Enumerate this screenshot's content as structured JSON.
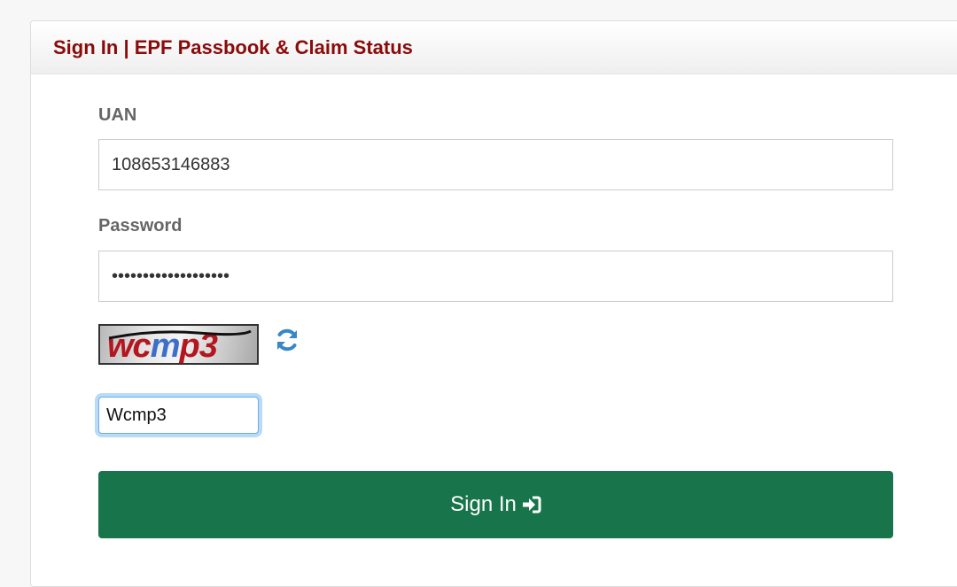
{
  "panel": {
    "title": "Sign In | EPF Passbook & Claim Status"
  },
  "form": {
    "uan_label": "UAN",
    "uan_value": "108653146883",
    "password_label": "Password",
    "password_value": "•••••••••••••••••••",
    "captcha_text": "wcmp3",
    "captcha_input_value": "Wcmp3",
    "signin_label": "Sign In"
  },
  "icons": {
    "refresh": "refresh-icon",
    "signin": "sign-in-icon"
  },
  "colors": {
    "title": "#8b0a0a",
    "button": "#18744a",
    "refresh": "#3a87c4",
    "captcha_red": "#b3161e",
    "captcha_blue": "#3b6fc9"
  }
}
